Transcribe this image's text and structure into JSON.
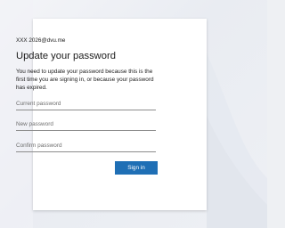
{
  "account": {
    "email": "XXX 2026@dvu.me"
  },
  "dialog": {
    "title": "Update your password",
    "description": "You need to update your password because this is the first time you are signing in, or because your password has expired."
  },
  "form": {
    "current_password_placeholder": "Current password",
    "new_password_placeholder": "New password",
    "confirm_password_placeholder": "Confirm password",
    "submit_label": "Sign in"
  },
  "colors": {
    "accent": "#1f6fb5",
    "card": "#ffffff",
    "background": "#eef0f3"
  }
}
